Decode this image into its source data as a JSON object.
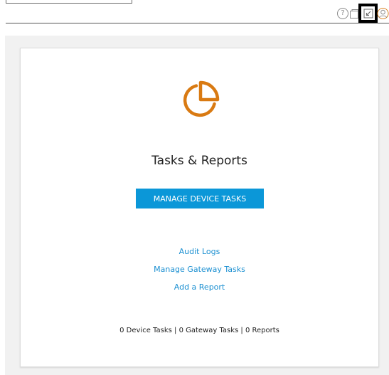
{
  "header": {
    "help_glyph": "?",
    "icons": [
      "help-icon",
      "apps-icon",
      "collapse-icon",
      "user-icon"
    ]
  },
  "card": {
    "icon": "pie-chart-icon",
    "accent_color": "#d97a12",
    "title": "Tasks & Reports",
    "primary_button_label": "MANAGE DEVICE TASKS",
    "primary_button_color": "#0b97d8",
    "links": [
      {
        "label": "Audit Logs"
      },
      {
        "label": "Manage Gateway Tasks"
      },
      {
        "label": "Add a Report"
      }
    ],
    "summary": {
      "device_tasks": "0 Device Tasks",
      "separator": " | ",
      "gateway_tasks": "0 Gateway Tasks",
      "reports": "0 Reports"
    }
  }
}
